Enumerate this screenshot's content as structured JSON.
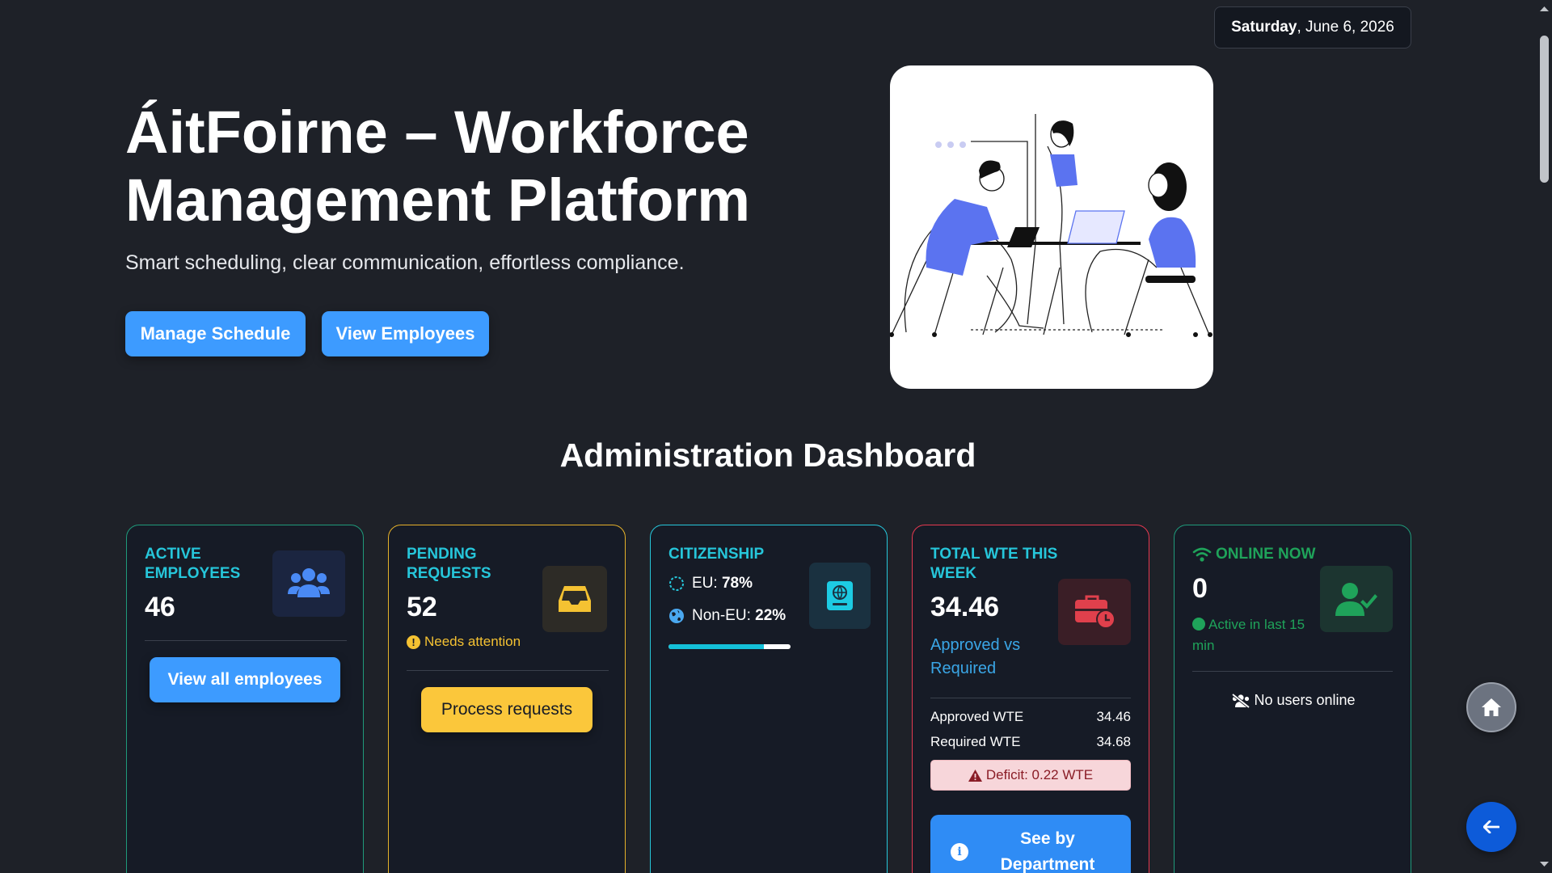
{
  "date": {
    "weekday": "Saturday",
    "rest": ", June 6, 2026"
  },
  "hero": {
    "title": "ÁitFoirne – Workforce Management Platform",
    "subtitle": "Smart scheduling, clear communication, effortless compliance.",
    "buttons": {
      "manage_schedule": "Manage Schedule",
      "view_employees": "View Employees"
    }
  },
  "dashboard": {
    "title": "Administration Dashboard"
  },
  "cards": {
    "active_employees": {
      "label": "Active Employees",
      "value": "46",
      "button": "View all employees",
      "color": "#26c6da",
      "border": "#1f9a7a"
    },
    "pending_requests": {
      "label": "Pending Requests",
      "value": "52",
      "note": "Needs attention",
      "button": "Process requests",
      "color": "#26c6da",
      "border": "#e5b12a"
    },
    "citizenship": {
      "label": "Citizenship",
      "eu_label": "EU:",
      "eu_value": "78%",
      "non_eu_label": "Non-EU:",
      "non_eu_value": "22%",
      "eu_fraction": 0.78,
      "color": "#26c6da",
      "border": "#26c6da"
    },
    "total_wte": {
      "label": "Total WTE this week",
      "value": "34.46",
      "note": "Approved vs Required",
      "approved_label": "Approved WTE",
      "approved_value": "34.46",
      "required_label": "Required WTE",
      "required_value": "34.68",
      "deficit": "Deficit: 0.22 WTE",
      "button": "See by Department",
      "color": "#26c6da",
      "border": "#e53950"
    },
    "online_now": {
      "label": "Online now",
      "value": "0",
      "note": "Active in last 15 min",
      "empty": "No users online",
      "color": "#1fa35a",
      "border": "#1f9a7a"
    }
  },
  "icons": [
    "users-icon",
    "inbox-icon",
    "passport-icon",
    "briefcase-clock-icon",
    "wifi-icon",
    "user-check-icon",
    "home-icon",
    "arrow-left-icon",
    "info-icon",
    "warning-icon",
    "exclamation-icon",
    "globe-icon",
    "circle-icon",
    "users-slash-icon"
  ]
}
